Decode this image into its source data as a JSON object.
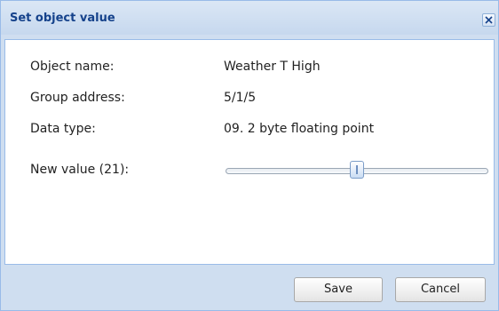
{
  "dialog": {
    "title": "Set object value",
    "close_icon": "close-icon"
  },
  "fields": {
    "object_name_label": "Object name:",
    "object_name_value": "Weather T High",
    "group_address_label": "Group address:",
    "group_address_value": "5/1/5",
    "data_type_label": "Data type:",
    "data_type_value": "09. 2 byte floating point",
    "new_value_label": "New value (21):"
  },
  "slider": {
    "position_fraction": 0.5
  },
  "buttons": {
    "save_label": "Save",
    "cancel_label": "Cancel"
  },
  "colors": {
    "title_text": "#15428b",
    "frame": "#cfdef0",
    "border": "#99bbe8"
  }
}
